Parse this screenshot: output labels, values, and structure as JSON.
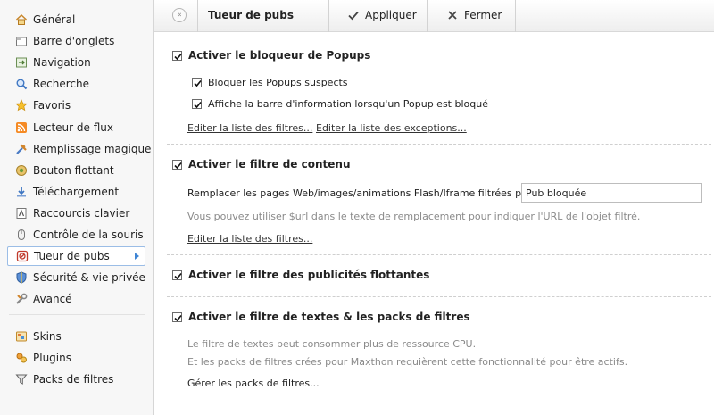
{
  "sidebar": {
    "items": [
      {
        "label": "Général",
        "icon": "home-icon"
      },
      {
        "label": "Barre d'onglets",
        "icon": "tabs-icon"
      },
      {
        "label": "Navigation",
        "icon": "navigation-icon"
      },
      {
        "label": "Recherche",
        "icon": "search-icon"
      },
      {
        "label": "Favoris",
        "icon": "star-icon"
      },
      {
        "label": "Lecteur de flux",
        "icon": "rss-icon"
      },
      {
        "label": "Remplissage magique",
        "icon": "tools-icon"
      },
      {
        "label": "Bouton flottant",
        "icon": "floating-button-icon"
      },
      {
        "label": "Téléchargement",
        "icon": "download-icon"
      },
      {
        "label": "Raccourcis clavier",
        "icon": "keyboard-icon"
      },
      {
        "label": "Contrôle de la souris",
        "icon": "mouse-icon"
      },
      {
        "label": "Tueur de pubs",
        "icon": "ad-killer-icon"
      },
      {
        "label": "Sécurité & vie privée",
        "icon": "shield-icon"
      },
      {
        "label": "Avancé",
        "icon": "wrench-icon"
      },
      {
        "label": "Skins",
        "icon": "skins-icon"
      },
      {
        "label": "Plugins",
        "icon": "plugins-icon"
      },
      {
        "label": "Packs de filtres",
        "icon": "filter-icon"
      }
    ],
    "active_index": 11
  },
  "toolbar": {
    "title": "Tueur de pubs",
    "apply_label": "Appliquer",
    "close_label": "Fermer"
  },
  "content": {
    "popup": {
      "title": "Activer le bloqueur de Popups",
      "checked": true,
      "option1": "Bloquer les Popups suspects",
      "option2": "Affiche la barre d'information lorsqu'un Popup est bloqué",
      "link_filters": "Editer la liste des filtres...",
      "link_exceptions": "Editer la liste des exceptions..."
    },
    "content_filter": {
      "title": "Activer le filtre de contenu",
      "checked": true,
      "replace_label": "Remplacer les pages Web/images/animations Flash/Iframe filtrées par :",
      "replace_value": "Pub bloquée",
      "hint": "Vous pouvez utiliser $url dans le texte de remplacement pour indiquer l'URL de l'objet filtré.",
      "link_filters": "Editer la liste des filtres..."
    },
    "floating": {
      "title": "Activer le filtre des publicités flottantes",
      "checked": true
    },
    "text_filter": {
      "title": "Activer le filtre de textes & les packs de filtres",
      "checked": true,
      "note1": "Le filtre de textes peut consommer plus de ressource CPU.",
      "note2": "Et les packs de filtres crées pour Maxthon requièrent cette fonctionnalité pour être actifs.",
      "link_manage": "Gérer les packs de filtres..."
    }
  },
  "colors": {
    "accent": "#3e84d4",
    "muted_text": "#8a8a8a"
  }
}
